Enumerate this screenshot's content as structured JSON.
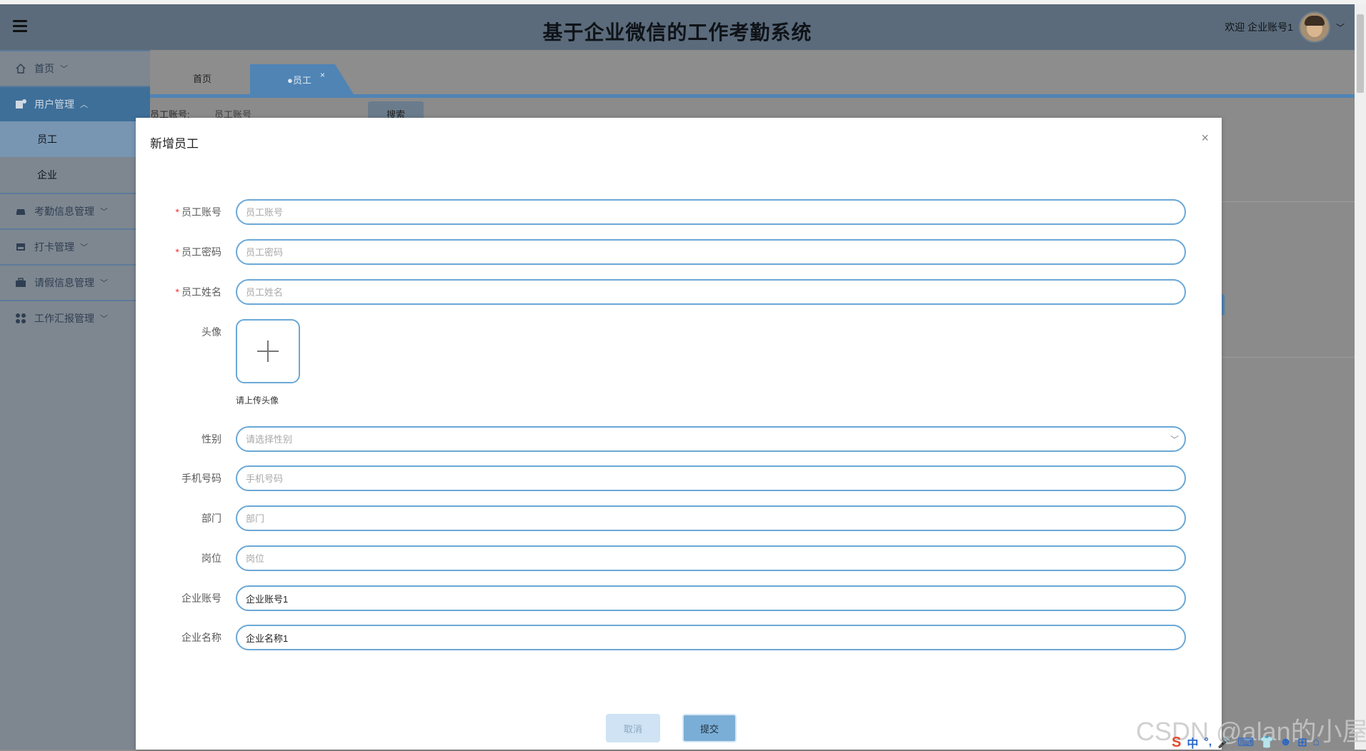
{
  "header": {
    "title": "基于企业微信的工作考勤系统",
    "welcome": "欢迎 企业账号1",
    "caret": "﹀"
  },
  "sidebar": {
    "items": [
      {
        "label": "首页",
        "arrow": "﹀",
        "icon": "home-icon"
      },
      {
        "label": "用户管理",
        "arrow": "︿",
        "icon": "user-icon"
      },
      {
        "label": "考勤信息管理",
        "arrow": "﹀",
        "icon": "car-icon"
      },
      {
        "label": "打卡管理",
        "arrow": "﹀",
        "icon": "store-icon"
      },
      {
        "label": "请假信息管理",
        "arrow": "﹀",
        "icon": "bag-icon"
      },
      {
        "label": "工作汇报管理",
        "arrow": "﹀",
        "icon": "grid-icon"
      }
    ],
    "subitems": [
      "员工",
      "企业"
    ]
  },
  "tabs": {
    "home": "首页",
    "active": "●员工",
    "close": "×"
  },
  "search": {
    "label": "员工账号:",
    "placeholder": "员工账号",
    "button": "搜索"
  },
  "dialog": {
    "title": "新增员工",
    "close": "×",
    "fields": [
      {
        "label": "员工账号",
        "required": true,
        "placeholder": "员工账号",
        "value": ""
      },
      {
        "label": "员工密码",
        "required": true,
        "placeholder": "员工密码",
        "value": ""
      },
      {
        "label": "员工姓名",
        "required": true,
        "placeholder": "员工姓名",
        "value": ""
      },
      {
        "label": "性别",
        "required": false,
        "placeholder": "请选择性别",
        "value": ""
      },
      {
        "label": "手机号码",
        "required": false,
        "placeholder": "手机号码",
        "value": ""
      },
      {
        "label": "部门",
        "required": false,
        "placeholder": "部门",
        "value": ""
      },
      {
        "label": "岗位",
        "required": false,
        "placeholder": "岗位",
        "value": ""
      },
      {
        "label": "企业账号",
        "required": false,
        "placeholder": "",
        "value": "企业账号1"
      },
      {
        "label": "企业名称",
        "required": false,
        "placeholder": "",
        "value": "企业名称1"
      }
    ],
    "avatar_label": "头像",
    "upload_hint": "请上传头像",
    "select_arrow": "﹀",
    "cancel": "取消",
    "submit": "提交",
    "required_mark": "*"
  },
  "watermark": "CSDN @alan的小屋",
  "tray": [
    "S",
    "中",
    "°,",
    "🎤",
    "⌨",
    "👕",
    "☻",
    "⊞",
    "⌂"
  ]
}
